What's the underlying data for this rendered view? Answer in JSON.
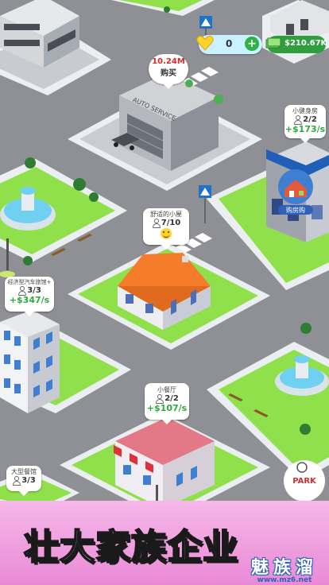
{
  "hud": {
    "gems": "0",
    "add_symbol": "+",
    "cash": "$210.67K"
  },
  "buy_bubble": {
    "price": "10.24M",
    "label": "购买"
  },
  "auto_service_sign": "AUTO SERVICE",
  "buildings": [
    {
      "name": "小健身房",
      "count": "2/2",
      "income": "+$173/s"
    },
    {
      "name": "舒适的小屋",
      "count": "7/10",
      "income": ""
    },
    {
      "name": "经济型汽车旅馆+",
      "count": "3/3",
      "income": "+$347/s"
    },
    {
      "name": "小餐厅",
      "count": "2/2",
      "income": "+$107/s"
    },
    {
      "name": "大型餐馆",
      "count": "3/3",
      "income": ""
    }
  ],
  "gym_badge_label": "购房购",
  "bottom_badge_text": "PARK",
  "banner": {
    "title": "壮大家族企业"
  },
  "watermark": {
    "name": "魅族溜",
    "url": "www.mz6.net"
  },
  "colors": {
    "road": "#8e9096",
    "grass": "#8fe04a",
    "sidewalk": "#eceff2",
    "income_green": "#2eaa3d",
    "banner_pink": "#f3a9e4"
  }
}
